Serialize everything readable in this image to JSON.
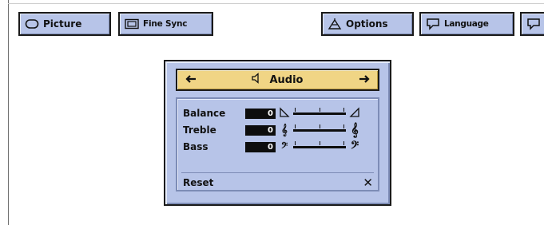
{
  "tabs": {
    "picture": "Picture",
    "fine_sync": "Fine Sync",
    "options": "Options",
    "language": "Language"
  },
  "audio": {
    "title": "Audio",
    "rows": [
      {
        "label": "Balance",
        "value": "0"
      },
      {
        "label": "Treble",
        "value": "0"
      },
      {
        "label": "Bass",
        "value": "0"
      }
    ],
    "reset_label": "Reset",
    "reset_symbol": "✕"
  },
  "icons": {
    "picture": "rounded-rectangle-icon",
    "fine_sync": "screen-icon",
    "options": "easel-icon",
    "language": "speech-bubble-icon",
    "audio": "speaker-icon"
  },
  "colors": {
    "tab_bg": "#b7c4e8",
    "title_bar": "#f0d585",
    "value_box": "#0d0d0d"
  }
}
